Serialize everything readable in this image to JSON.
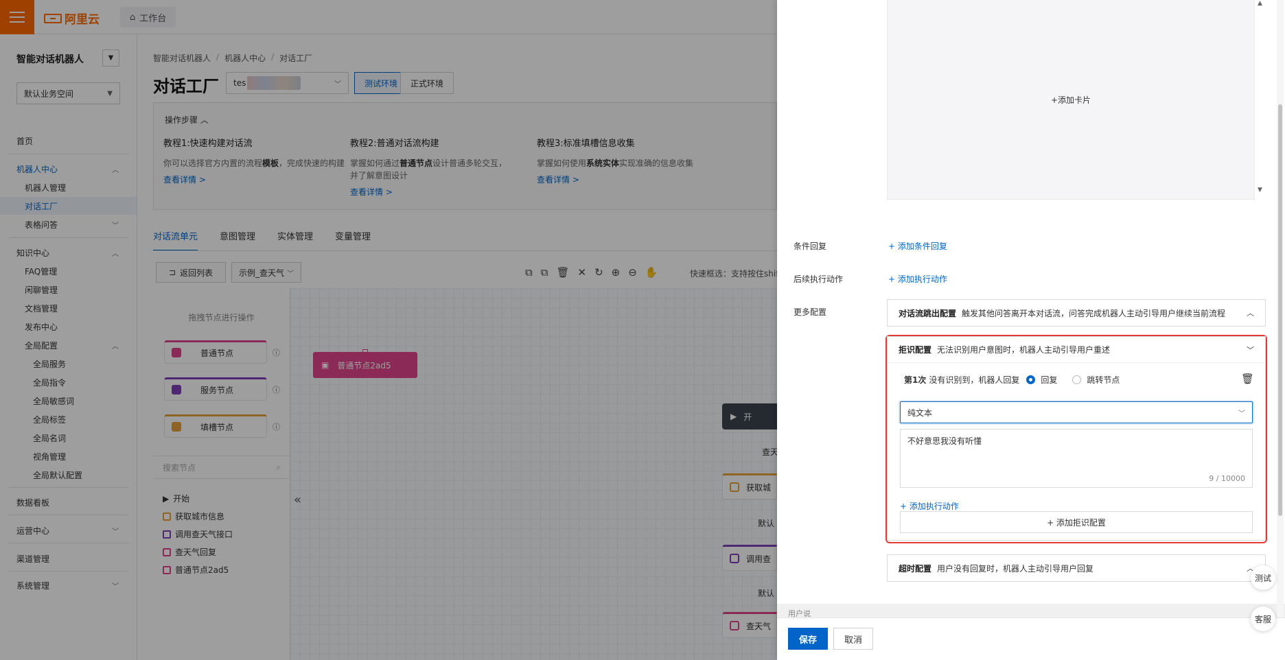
{
  "topbar": {
    "brand": "阿里云",
    "workbench": "工作台"
  },
  "sidebar": {
    "title": "智能对话机器人",
    "space": "默认业务空间",
    "items": [
      {
        "label": "首页"
      },
      {
        "label": "机器人中心"
      },
      {
        "label": "机器人管理"
      },
      {
        "label": "对话工厂"
      },
      {
        "label": "表格问答"
      },
      {
        "label": "知识中心"
      },
      {
        "label": "FAQ管理"
      },
      {
        "label": "闲聊管理"
      },
      {
        "label": "文档管理"
      },
      {
        "label": "发布中心"
      },
      {
        "label": "全局配置"
      },
      {
        "label": "全局服务"
      },
      {
        "label": "全局指令"
      },
      {
        "label": "全局敏感词"
      },
      {
        "label": "全局标签"
      },
      {
        "label": "全局名词"
      },
      {
        "label": "视角管理"
      },
      {
        "label": "全局默认配置"
      },
      {
        "label": "数据看板"
      },
      {
        "label": "运营中心"
      },
      {
        "label": "渠道管理"
      },
      {
        "label": "系统管理"
      }
    ]
  },
  "main": {
    "breadcrumb": [
      "智能对话机器人",
      "机器人中心",
      "对话工厂"
    ],
    "title": "对话工厂",
    "bot_select_prefix": "tes",
    "env_test": "测试环境",
    "env_prod": "正式环境",
    "steps_title": "操作步骤",
    "tutorials": [
      {
        "title": "教程1:快速构建对话流",
        "desc_a": "你可以选择官方内置的流程",
        "desc_b": "模板",
        "desc_c": "，完成快速的构建",
        "link": "查看详情 >"
      },
      {
        "title": "教程2:普通对话流构建",
        "desc_a": "掌握如何通过",
        "desc_b": "普通节点",
        "desc_c": "设计普通多轮交互，并了解意图设计",
        "link": "查看详情 >"
      },
      {
        "title": "教程3:标准填槽信息收集",
        "desc_a": "掌握如何使用",
        "desc_b": "系统实体",
        "desc_c": "实现准确的信息收集",
        "link": "查看详情 >"
      }
    ],
    "tabs": [
      "对话流单元",
      "意图管理",
      "实体管理",
      "变量管理"
    ],
    "back_list": "返回列表",
    "flow_select": "示例_查天气",
    "tool_hint": "快速框选：支持按住shift",
    "palette_hint": "拖拽节点进行操作",
    "palette_nodes": [
      "普通节点",
      "服务节点",
      "填槽节点"
    ],
    "search_placeholder": "搜索节点",
    "tree": [
      "开始",
      "获取城市信息",
      "调用查天气接口",
      "查天气回复",
      "普通节点2ad5"
    ],
    "canvas_node": "普通节点2ad5",
    "canvas_start": "开",
    "edge_labels": [
      "查天",
      "默认",
      "默认"
    ],
    "flow_nodes": [
      "获取城",
      "调用查",
      "查天气"
    ]
  },
  "drawer": {
    "add_card": "+添加卡片",
    "cond_reply_label": "条件回复",
    "cond_reply_link": "+ 添加条件回复",
    "next_action_label": "后续执行动作",
    "next_action_link": "+ 添加执行动作",
    "more_config_label": "更多配置",
    "exit_title": "对话流跳出配置",
    "exit_desc": "触发其他问答离开本对话流，问答完成机器人主动引导用户继续当前流程",
    "reject_title": "拒识配置",
    "reject_desc": "无法识别用户意图时，机器人主动引导用户重述",
    "reject_nth": "第1次",
    "reject_nth_desc": "没有识别到，机器人回复",
    "opt_reply": "回复",
    "opt_jump": "跳转节点",
    "type_value": "纯文本",
    "reply_text": "不好意思我没有听懂",
    "reply_count": "9 / 10000",
    "add_exec": "+ 添加执行动作",
    "add_reject": "+ 添加拒识配置",
    "timeout_title": "超时配置",
    "timeout_desc": "用户没有回复时，机器人主动引导用户回复",
    "advanced_cut": "用户说",
    "save": "保存",
    "cancel": "取消",
    "float_test": "测试",
    "float_service": "客服"
  },
  "colors": {
    "accent": "#0064c8",
    "brand": "#ff6a00",
    "highlight": "#e33a32"
  }
}
